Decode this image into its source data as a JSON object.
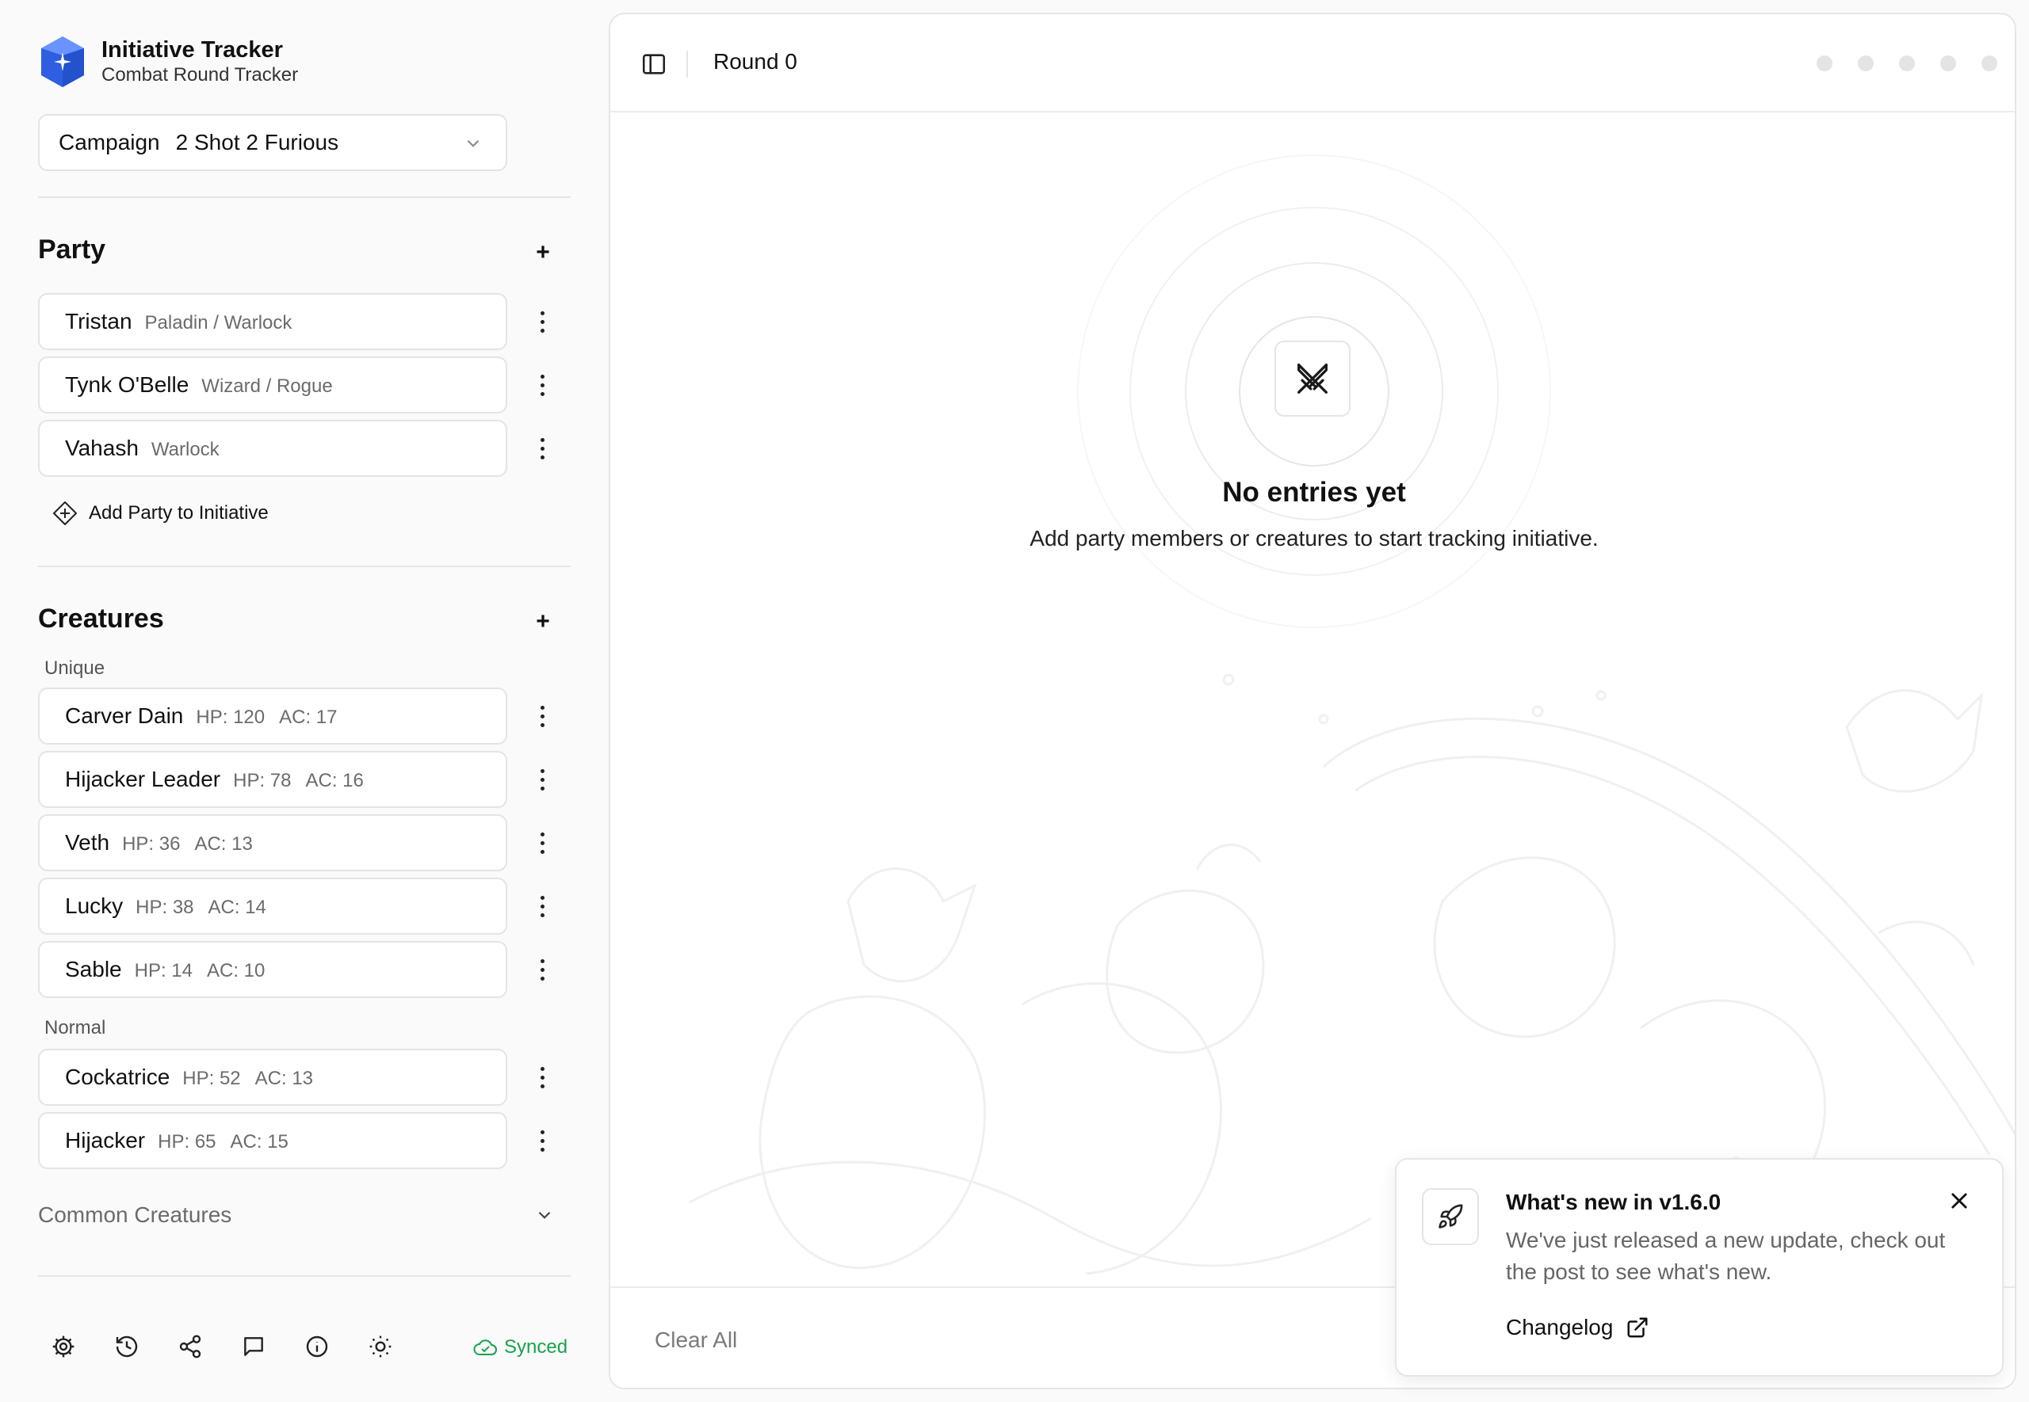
{
  "brand": {
    "title": "Initiative Tracker",
    "subtitle": "Combat Round Tracker"
  },
  "campaign": {
    "label": "Campaign",
    "value": "2 Shot 2 Furious"
  },
  "party": {
    "title": "Party",
    "members": [
      {
        "name": "Tristan",
        "class": "Paladin / Warlock"
      },
      {
        "name": "Tynk O'Belle",
        "class": "Wizard / Rogue"
      },
      {
        "name": "Vahash",
        "class": "Warlock"
      }
    ],
    "add_label": "Add Party to Initiative"
  },
  "creatures": {
    "title": "Creatures",
    "unique_label": "Unique",
    "unique": [
      {
        "name": "Carver Dain",
        "hp": "HP: 120",
        "ac": "AC: 17"
      },
      {
        "name": "Hijacker Leader",
        "hp": "HP: 78",
        "ac": "AC: 16"
      },
      {
        "name": "Veth",
        "hp": "HP: 36",
        "ac": "AC: 13"
      },
      {
        "name": "Lucky",
        "hp": "HP: 38",
        "ac": "AC: 14"
      },
      {
        "name": "Sable",
        "hp": "HP: 14",
        "ac": "AC: 10"
      }
    ],
    "normal_label": "Normal",
    "normal": [
      {
        "name": "Cockatrice",
        "hp": "HP: 52",
        "ac": "AC: 13"
      },
      {
        "name": "Hijacker",
        "hp": "HP: 65",
        "ac": "AC: 15"
      }
    ],
    "common_label": "Common Creatures"
  },
  "footer": {
    "icons": [
      "gear-icon",
      "history-icon",
      "share-icon",
      "message-icon",
      "info-icon",
      "sun-icon"
    ],
    "sync_status": "Synced",
    "sync_color": "#16a34a"
  },
  "main": {
    "round_label": "Round 0",
    "empty_title": "No entries yet",
    "empty_subtitle": "Add party members or creatures to start tracking initiative.",
    "clear_all": "Clear All"
  },
  "toast": {
    "title": "What's new in v1.6.0",
    "body": "We've just released a new update, check out the post to see what's new.",
    "link": "Changelog"
  },
  "colors": {
    "accent": "#3b6cf0",
    "border": "#e4e4e7",
    "muted": "#6b6b6b"
  }
}
